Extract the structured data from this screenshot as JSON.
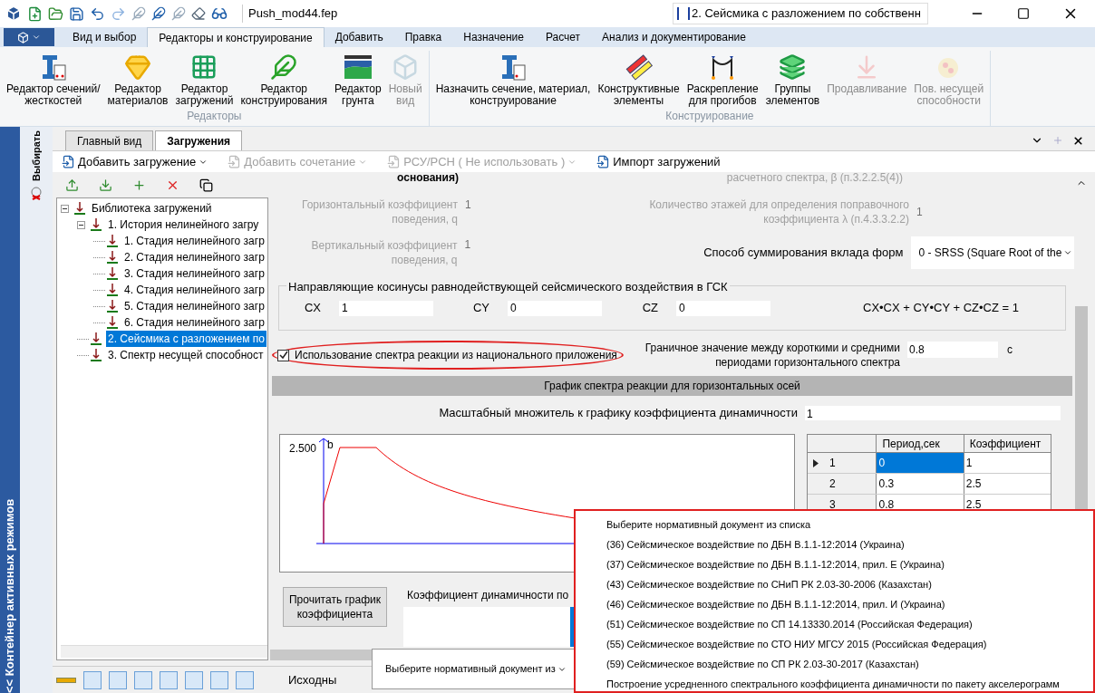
{
  "title_bar": {
    "filename": "Push_mod44.fep",
    "case_selector": "2. Сейсмика с разложением по собственн"
  },
  "ribbon": {
    "tabs": [
      {
        "label": "Вид и выбор",
        "selected": false
      },
      {
        "label": "Редакторы и конструирование",
        "selected": true
      },
      {
        "label": "Добавить",
        "selected": false
      },
      {
        "label": "Правка",
        "selected": false
      },
      {
        "label": "Назначение",
        "selected": false
      },
      {
        "label": "Расчет",
        "selected": false
      },
      {
        "label": "Анализ и документирование",
        "selected": false
      }
    ],
    "groups": [
      {
        "label": "Редакторы",
        "buttons": [
          {
            "label": "Редактор сечений/\nжесткостей",
            "disabled": false
          },
          {
            "label": "Редактор\nматериалов",
            "disabled": false
          },
          {
            "label": "Редактор\nзагружений",
            "disabled": false
          },
          {
            "label": "Редактор\nконструирования",
            "disabled": false
          },
          {
            "label": "Редактор\nгрунта",
            "disabled": false
          },
          {
            "label": "Новый\nвид",
            "disabled": true
          }
        ]
      },
      {
        "label": "Конструирование",
        "buttons": [
          {
            "label": "Назначить сечение, материал,\nконструирование",
            "disabled": false
          },
          {
            "label": "Конструктивные\nэлементы",
            "disabled": false
          },
          {
            "label": "Раскрепление\nдля прогибов",
            "disabled": false
          },
          {
            "label": "Группы\nэлементов",
            "disabled": false
          },
          {
            "label": "Продавливание",
            "disabled": true
          },
          {
            "label": "Пов. несущей\nспособности",
            "disabled": true
          }
        ]
      }
    ]
  },
  "side_panel": {
    "title": "<< Контейнер активных режимов",
    "tab": "Выбирать"
  },
  "document_tabs": [
    {
      "label": "Главный вид",
      "selected": false
    },
    {
      "label": "Загружения",
      "selected": true
    }
  ],
  "toolbar": [
    {
      "label": "Добавить загружение",
      "disabled": false,
      "dropdown": true
    },
    {
      "label": "Добавить сочетание",
      "disabled": true,
      "dropdown": true
    },
    {
      "label": "РСУ/РСН ( Не использовать )",
      "disabled": true,
      "dropdown": true
    },
    {
      "label": "Импорт загружений",
      "disabled": false,
      "dropdown": false
    }
  ],
  "tree": {
    "label": "Библиотека загружений",
    "expanded": true,
    "selected": false,
    "children": [
      {
        "label": "1. История нелинейного загру",
        "expanded": true,
        "selected": false,
        "children": [
          {
            "label": "1. Стадия нелинейного загр",
            "selected": false
          },
          {
            "label": "2. Стадия нелинейного загр",
            "selected": false
          },
          {
            "label": "3. Стадия нелинейного загр",
            "selected": false
          },
          {
            "label": "4. Стадия нелинейного загр",
            "selected": false
          },
          {
            "label": "5. Стадия нелинейного загр",
            "selected": false
          },
          {
            "label": "6. Стадия нелинейного загр",
            "selected": false
          }
        ]
      },
      {
        "label": "2. Сейсмика с разложением по",
        "selected": true
      },
      {
        "label": "3. Спектр несущей способност",
        "selected": false
      }
    ]
  },
  "form": {
    "clipped_top": [
      "основания)",
      "расчетного спектра, β (п.3.2.2.5(4))"
    ],
    "horizontal_q": {
      "label": "Горизонтальный коэффициент\nповедения, q",
      "value": "1",
      "disabled": true
    },
    "floors": {
      "label": "Количество этажей для определения поправочного\nкоэффициента λ (п.4.3.3.2.2)",
      "value": "1",
      "disabled": true
    },
    "vertical_q": {
      "label": "Вертикальный коэффициент\nповедения, q",
      "value": "1",
      "disabled": true
    },
    "summation": {
      "label": "Способ суммирования вклада форм",
      "value": "0 - SRSS (Square Root of the"
    },
    "cosines": {
      "legend": "Направляющие косинусы равнодействующей сейсмического воздействия в ГСК",
      "fields": [
        {
          "label": "CX",
          "value": "1"
        },
        {
          "label": "CY",
          "value": "0"
        },
        {
          "label": "CZ",
          "value": "0"
        }
      ],
      "formula": "CX•CX + CY•CY + CZ•CZ = 1"
    },
    "national_annex": {
      "label": "Использование спектра реакции из национального приложения",
      "checked": true,
      "highlighted": true
    },
    "boundary": {
      "label": "Граничное значение между короткими и средними\nпериодами горизонтального спектра",
      "value": "0.8",
      "unit": "с"
    },
    "section_header": "График спектра реакции для горизонтальных осей",
    "scale": {
      "label": "Масштабный множитель к графику коэффициента динамичности",
      "value": "1"
    },
    "chart": {
      "y_label": "2.500",
      "axis_label": "b"
    },
    "table": {
      "columns": [
        "Период,сек",
        "Коэффициент"
      ],
      "rows": [
        {
          "index": "1",
          "period": "0",
          "coefficient": "1",
          "selected": true
        },
        {
          "index": "2",
          "period": "0.3",
          "coefficient": "2.5",
          "selected": false
        },
        {
          "index": "3",
          "period": "0.8",
          "coefficient": "2.5",
          "selected": false
        }
      ]
    },
    "read_button": "Прочитать график\nкоэффициента",
    "coefficient_label": "Коэффициент динамичности по",
    "document_select": "Выберите нормативный документ из"
  },
  "document_list": {
    "highlighted": true,
    "items": [
      "Выберите нормативный документ из списка",
      "(36) Сейсмическое воздействие по ДБН В.1.1-12:2014 (Украина)",
      "(37) Сейсмическое воздействие по ДБН В.1.1-12:2014, прил. Е (Украина)",
      "(43) Сейсмическое воздействие по СНиП РК 2.03-30-2006 (Казахстан)",
      "(46) Сейсмическое воздействие по ДБН В.1.1-12:2014, прил. И (Украина)",
      "(51) Сейсмическое воздействие по СП 14.13330.2014 (Российская Федерация)",
      "(55) Сейсмическое воздействие по СТО НИУ МГСУ 2015 (Российская Федерация)",
      "(59) Сейсмическое воздействие по СП РК 2.03-30-2017 (Казахстан)",
      "Построение усредненного спектрального коэффициента динамичности по пакету акселерограмм"
    ]
  },
  "status_bar": {
    "label": "Исходны"
  }
}
